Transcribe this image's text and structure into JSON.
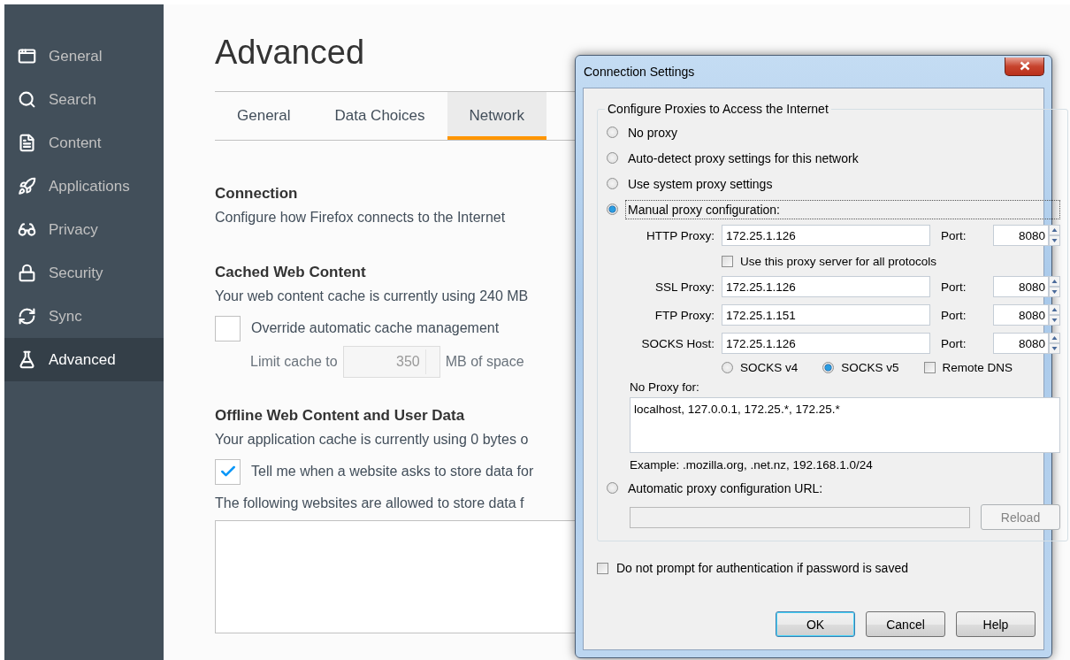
{
  "sidebar": {
    "items": [
      {
        "label": "General",
        "selected": false
      },
      {
        "label": "Search",
        "selected": false
      },
      {
        "label": "Content",
        "selected": false
      },
      {
        "label": "Applications",
        "selected": false
      },
      {
        "label": "Privacy",
        "selected": false
      },
      {
        "label": "Security",
        "selected": false
      },
      {
        "label": "Sync",
        "selected": false
      },
      {
        "label": "Advanced",
        "selected": true
      }
    ]
  },
  "page": {
    "title": "Advanced",
    "tabs": [
      {
        "label": "General",
        "selected": false
      },
      {
        "label": "Data Choices",
        "selected": false
      },
      {
        "label": "Network",
        "selected": true
      }
    ],
    "connection": {
      "heading": "Connection",
      "description": "Configure how Firefox connects to the Internet"
    },
    "cache": {
      "heading": "Cached Web Content",
      "description": "Your web content cache is currently using 240 MB",
      "override": {
        "label": "Override automatic cache management",
        "checked": false
      },
      "limit": {
        "label": "Limit cache to",
        "value": "350",
        "unit": "MB of space",
        "disabled": true
      }
    },
    "offline": {
      "heading": "Offline Web Content and User Data",
      "description": "Your application cache is currently using 0 bytes o",
      "notify": {
        "label": "Tell me when a website asks to store data for",
        "checked": true
      },
      "list_label": "The following websites are allowed to store data f"
    }
  },
  "dialog": {
    "title": "Connection Settings",
    "legend": "Configure Proxies to Access the Internet",
    "modes": [
      {
        "label": "No proxy",
        "selected": false
      },
      {
        "label": "Auto-detect proxy settings for this network",
        "selected": false
      },
      {
        "label": "Use system proxy settings",
        "selected": false
      },
      {
        "label": "Manual proxy configuration:",
        "selected": true
      }
    ],
    "proxies": [
      {
        "label": "HTTP Proxy:",
        "value": "172.25.1.126",
        "port_label": "Port:",
        "port": "8080"
      },
      {
        "label": "SSL Proxy:",
        "value": "172.25.1.126",
        "port_label": "Port:",
        "port": "8080"
      },
      {
        "label": "FTP Proxy:",
        "value": "172.25.1.151",
        "port_label": "Port:",
        "port": "8080"
      },
      {
        "label": "SOCKS Host:",
        "value": "172.25.1.126",
        "port_label": "Port:",
        "port": "8080"
      }
    ],
    "use_for_all": {
      "label": "Use this proxy server for all protocols",
      "checked": false
    },
    "socks_versions": [
      {
        "label": "SOCKS v4",
        "selected": false
      },
      {
        "label": "SOCKS v5",
        "selected": true
      }
    ],
    "remote_dns": {
      "label": "Remote DNS",
      "checked": false
    },
    "no_proxy": {
      "label": "No Proxy for:",
      "value": "localhost, 127.0.0.1, 172.25.*, 172.25.*",
      "example": "Example: .mozilla.org, .net.nz, 192.168.1.0/24"
    },
    "auto_url": {
      "label": "Automatic proxy configuration URL:",
      "selected": false,
      "disabled": true,
      "reload": "Reload"
    },
    "auth": {
      "label": "Do not prompt for authentication if password is saved",
      "checked": false
    },
    "buttons": [
      {
        "label": "OK",
        "default": true
      },
      {
        "label": "Cancel",
        "default": false
      },
      {
        "label": "Help",
        "default": false
      }
    ]
  }
}
